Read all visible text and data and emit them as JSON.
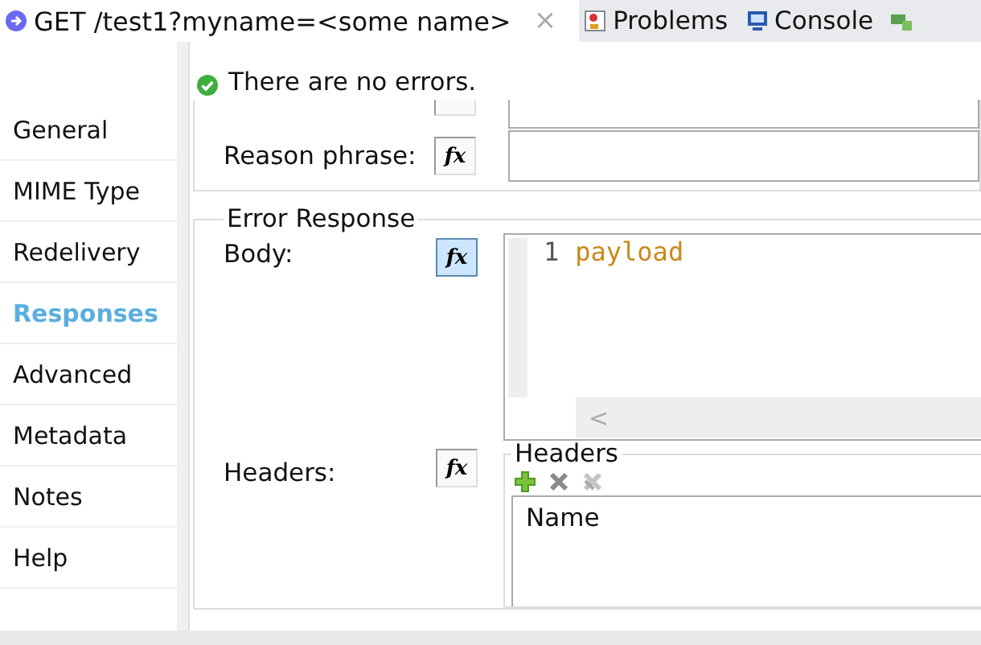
{
  "tabs": [
    {
      "label": "GET /test1?myname=<some name>",
      "kind": "editor",
      "selected": true,
      "close": "×"
    },
    {
      "label": "Problems",
      "kind": "problems",
      "selected": false
    },
    {
      "label": "Console",
      "kind": "console",
      "selected": false
    }
  ],
  "banner": {
    "message": "There are no errors."
  },
  "sidebar": {
    "items": [
      {
        "label": "General",
        "selected": false
      },
      {
        "label": "MIME Type",
        "selected": false
      },
      {
        "label": "Redelivery",
        "selected": false
      },
      {
        "label": "Responses",
        "selected": true
      },
      {
        "label": "Advanced",
        "selected": false
      },
      {
        "label": "Metadata",
        "selected": false
      },
      {
        "label": "Notes",
        "selected": false
      },
      {
        "label": "Help",
        "selected": false
      }
    ]
  },
  "top_rows": [
    {
      "kind": "cut"
    },
    {
      "label": "Reason phrase:",
      "fx": {
        "label": "fx",
        "selected": false
      }
    }
  ],
  "error_response": {
    "title": "Error Response",
    "body": {
      "label": "Body:",
      "fx": {
        "label": "fx",
        "selected": true
      },
      "line_number": "1",
      "code": "payload",
      "scroll_left": "<"
    },
    "headers": {
      "label": "Headers:",
      "fx": {
        "label": "fx",
        "selected": false
      },
      "group_title": "Headers",
      "column": "Name"
    }
  }
}
